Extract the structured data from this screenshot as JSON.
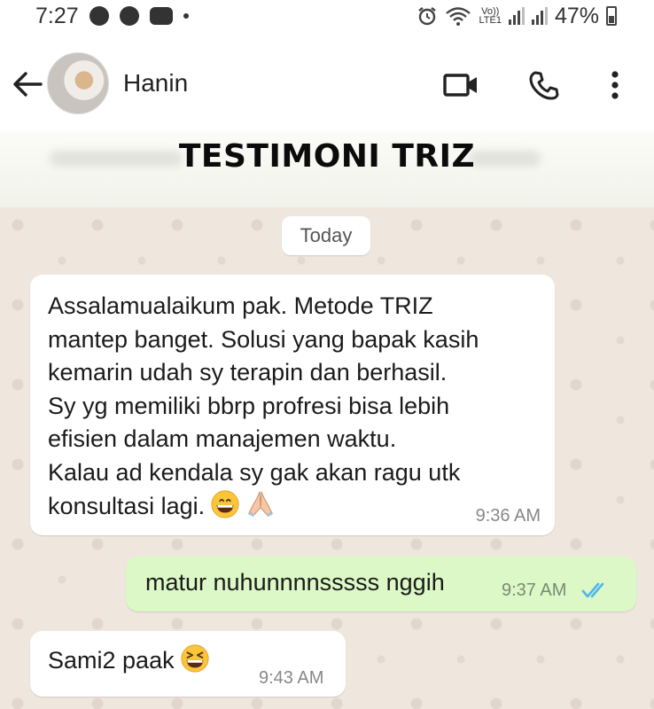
{
  "status_bar": {
    "time": "7:27",
    "volte_label_top": "Vo))",
    "volte_label_bottom": "LTE1",
    "battery_percent": "47%"
  },
  "header": {
    "contact_name": "Hanin",
    "icons": [
      "back-arrow-icon",
      "avatar",
      "video-call-icon",
      "phone-icon",
      "more-options-icon"
    ]
  },
  "banner": {
    "title": "TESTIMONI TRIZ"
  },
  "chat": {
    "date_chip": "Today",
    "messages": [
      {
        "direction": "incoming",
        "text": "Assalamualaikum pak. Metode TRIZ\nmantep banget. Solusi yang bapak kasih\nkemarin udah sy terapin dan berhasil.\nSy yg memiliki bbrp profresi bisa lebih\nefisien dalam manajemen waktu.\nKalau ad kendala sy gak akan ragu utk\nkonsultasi lagi.",
        "time": "9:36 AM",
        "emojis": [
          "grinning-face",
          "folded-hands"
        ]
      },
      {
        "direction": "outgoing",
        "text": "matur nuhunnnnsssss nggih",
        "time": "9:37 AM",
        "status": "read",
        "status_color": "#4fb6ec"
      },
      {
        "direction": "incoming",
        "text": "Sami2 paak",
        "time": "9:43 AM",
        "emojis": [
          "laughing-squinting-face"
        ]
      }
    ]
  },
  "colors": {
    "outgoing_bubble": "#dcf8c6",
    "incoming_bubble": "#ffffff",
    "wallpaper": "#efe7de"
  }
}
